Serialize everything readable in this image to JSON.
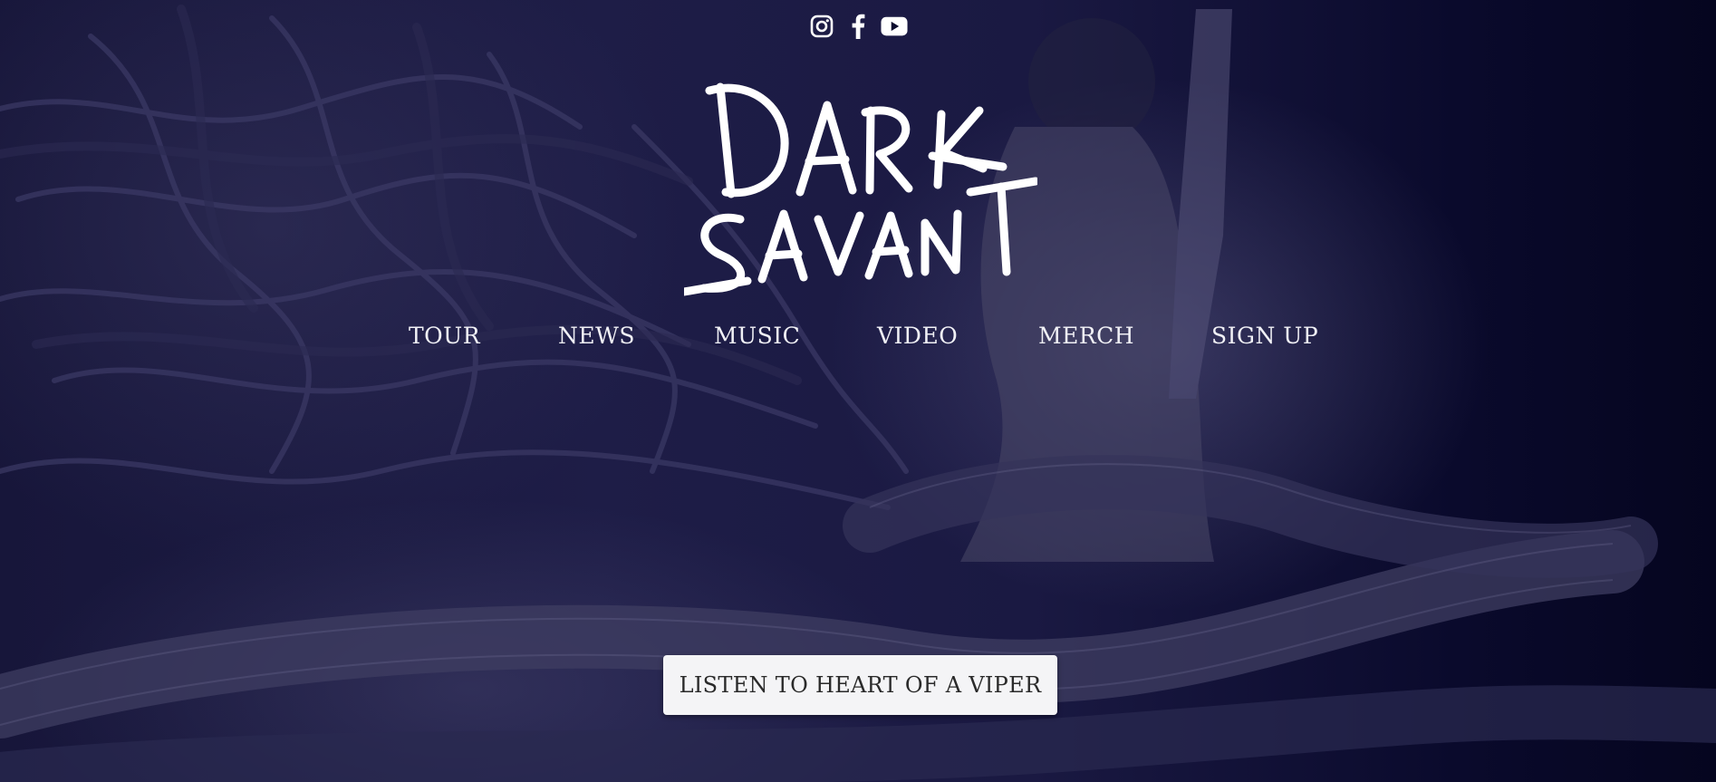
{
  "social": {
    "items": [
      {
        "icon": "instagram-icon"
      },
      {
        "icon": "facebook-icon"
      },
      {
        "icon": "youtube-icon"
      }
    ]
  },
  "logo": {
    "line1": "DARK",
    "line2": "SAVANT"
  },
  "nav": {
    "items": [
      "TOUR",
      "NEWS",
      "MUSIC",
      "VIDEO",
      "MERCH",
      "SIGN UP"
    ]
  },
  "cta": {
    "label": "LISTEN TO HEART OF A VIPER"
  },
  "colors": {
    "background": "#06062a",
    "text": "#f1f1f6",
    "button_bg": "#f4f4f6",
    "button_text": "#2a2a2a"
  }
}
